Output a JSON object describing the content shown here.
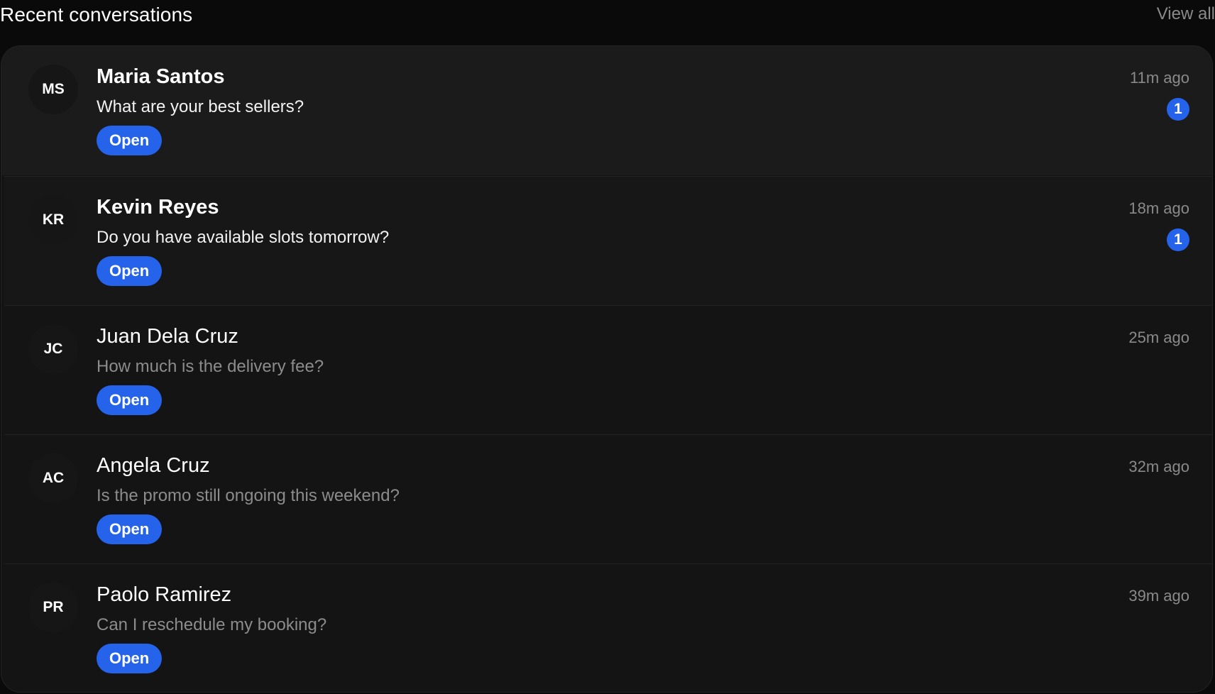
{
  "header": {
    "title": "Recent conversations",
    "view_all": "View all"
  },
  "conversations": [
    {
      "initials": "MS",
      "name": "Maria Santos",
      "preview": "What are your best sellers?",
      "time": "11m ago",
      "unread": "1",
      "action": "Open"
    },
    {
      "initials": "KR",
      "name": "Kevin Reyes",
      "preview": "Do you have available slots tomorrow?",
      "time": "18m ago",
      "unread": "1",
      "action": "Open"
    },
    {
      "initials": "JC",
      "name": "Juan Dela Cruz",
      "preview": "How much is the delivery fee?",
      "time": "25m ago",
      "action": "Open"
    },
    {
      "initials": "AC",
      "name": "Angela Cruz",
      "preview": "Is the promo still ongoing this weekend?",
      "time": "32m ago",
      "action": "Open"
    },
    {
      "initials": "PR",
      "name": "Paolo Ramirez",
      "preview": "Can I reschedule my booking?",
      "time": "39m ago",
      "action": "Open"
    }
  ],
  "colors": {
    "accent": "#2563eb",
    "background": "#0a0a0a",
    "card": "#141414",
    "muted_text": "#8a8a8a"
  }
}
